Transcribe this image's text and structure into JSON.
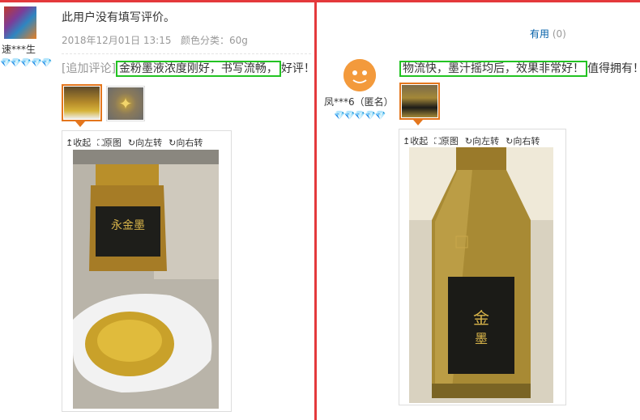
{
  "left_review": {
    "username": "速***生",
    "hearts": "💎💎💎💎💎",
    "comment": "此用户没有填写评价。",
    "date": "2018年12月01日 13:15",
    "color_label": "颜色分类：60g",
    "append_label": "[追加评论]",
    "append_highlight": "金粉墨液浓度刚好，书写流畅，",
    "append_rest": "好评！",
    "viewer": {
      "collapse": "↥收起",
      "original": "⛶原图",
      "rotate_left": "↻向左转",
      "rotate_right": "↻向右转"
    }
  },
  "right_review": {
    "useful_label": "有用",
    "useful_count": "(0)",
    "username": "凤***6（匿名）",
    "hearts": "💎💎💎💎💎",
    "comment_highlight": "物流快，墨汁摇均后，效果非常好！",
    "comment_rest": "值得拥有！",
    "viewer": {
      "collapse": "↥收起",
      "original": "⛶原图",
      "rotate_left": "↻向左转",
      "rotate_right": "↻向右转"
    }
  },
  "colors": {
    "accent_red": "#e4393c",
    "highlight_green": "#22c322",
    "thumb_selected": "#e4761d",
    "link_blue": "#005ea7"
  }
}
